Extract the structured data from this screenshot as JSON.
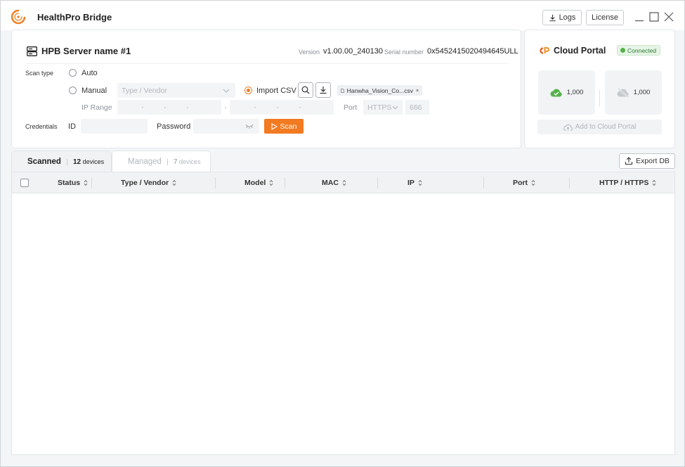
{
  "app": {
    "title": "HealthPro Bridge",
    "logs_label": "Logs",
    "license_label": "License"
  },
  "server": {
    "name": "HPB Server name #1",
    "version_label": "Version",
    "version_value": "v1.00.00_240130",
    "serial_label": "Serial number",
    "serial_value": "0x5452415020494645ULL",
    "scan_type_label": "Scan type",
    "auto_label": "Auto",
    "manual_label": "Manual",
    "type_vendor_placeholder": "Type / Vendor",
    "import_csv_label": "Import CSV",
    "csv_file": "Hanwha_Vision_Co...csv",
    "ip_range_label": "IP Range",
    "port_label": "Port",
    "port_protocol": "HTTPS",
    "port_number": "666",
    "credentials_label": "Credentials",
    "id_label": "ID",
    "password_label": "Password",
    "scan_label": "Scan",
    "selected_scan_type": "Import CSV"
  },
  "cloud": {
    "title": "Cloud Portal",
    "status": "Connected",
    "online_count": "1,000",
    "offline_count": "1,000",
    "add_label": "Add to Cloud Portal"
  },
  "tabs": [
    {
      "name": "Scanned",
      "count": "12",
      "unit": "devices",
      "active": true
    },
    {
      "name": "Managed",
      "count": "7",
      "unit": "devices",
      "active": false
    }
  ],
  "export_label": "Export DB",
  "table": {
    "columns": [
      "Status",
      "Type / Vendor",
      "Model",
      "MAC",
      "IP",
      "Port",
      "HTTP / HTTPS"
    ],
    "rows": []
  },
  "colors": {
    "accent": "#f27a20",
    "connected": "#55b14a"
  }
}
